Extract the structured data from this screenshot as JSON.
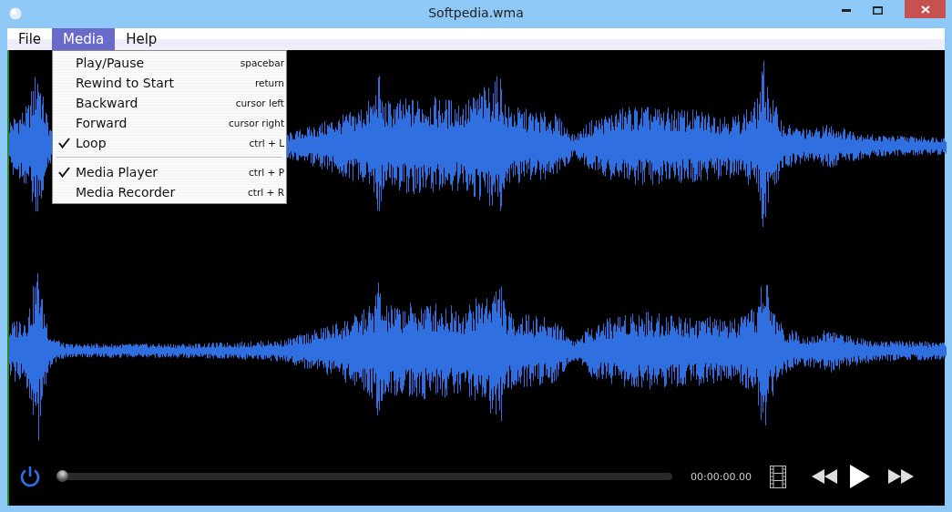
{
  "window": {
    "title": "Softpedia.wma"
  },
  "menu_bar": [
    {
      "label": "File",
      "selected": false
    },
    {
      "label": "Media",
      "selected": true
    },
    {
      "label": "Help",
      "selected": false
    }
  ],
  "media_menu": [
    {
      "kind": "item",
      "label": "Play/Pause",
      "shortcut": "spacebar",
      "checked": false
    },
    {
      "kind": "item",
      "label": "Rewind to Start",
      "shortcut": "return",
      "checked": false
    },
    {
      "kind": "item",
      "label": "Backward",
      "shortcut": "cursor left",
      "checked": false
    },
    {
      "kind": "item",
      "label": "Forward",
      "shortcut": "cursor right",
      "checked": false
    },
    {
      "kind": "item",
      "label": "Loop",
      "shortcut": "ctrl + L",
      "checked": true
    },
    {
      "kind": "separator"
    },
    {
      "kind": "item",
      "label": "Media Player",
      "shortcut": "ctrl + P",
      "checked": true
    },
    {
      "kind": "item",
      "label": "Media Recorder",
      "shortcut": "ctrl + R",
      "checked": false
    }
  ],
  "player": {
    "position": {
      "level": 0
    },
    "time": "00:00:00.00"
  }
}
